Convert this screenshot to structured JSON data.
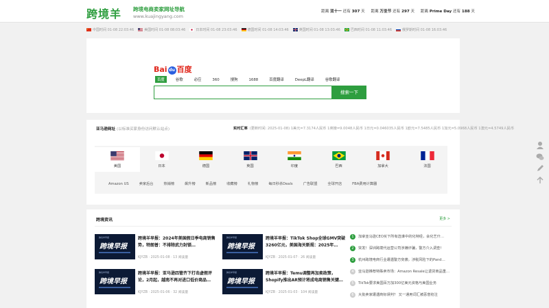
{
  "header": {
    "logo_mark": "跨境羊",
    "tagline": "跨境电商卖家网址导航",
    "domain": "www.kuajingyang.com",
    "countdowns": [
      {
        "pre": "距离",
        "name": "双十一",
        "mid": "还有",
        "days": "307",
        "unit": "天"
      },
      {
        "pre": "距离",
        "name": "万圣节",
        "mid": "还有",
        "days": "297",
        "unit": "天"
      },
      {
        "pre": "距离",
        "name": "Prime Day",
        "mid": "还有",
        "days": "188",
        "unit": "天"
      }
    ]
  },
  "timezones": [
    {
      "label": "中国时间 01-08 22:03:46",
      "flag": "cn"
    },
    {
      "label": "美国时间 01-08 08:03:46",
      "flag": "us"
    },
    {
      "label": "日本时间 01-08 23:03:46",
      "flag": "jp"
    },
    {
      "label": "德国时间 01-08 14:03:46",
      "flag": "de"
    },
    {
      "label": "英国时间 01-08 13:03:46",
      "flag": "gb"
    },
    {
      "label": "巴西时间 01-08 11:03:46",
      "flag": "br"
    },
    {
      "label": "俄罗斯时间 01-08 16:03:46",
      "flag": "ru"
    }
  ],
  "search": {
    "logo_left": "Bai",
    "logo_paw": "du",
    "logo_right": "百度",
    "tabs": [
      "百度",
      "谷歌",
      "必应",
      "360",
      "搜狗",
      "1688",
      "百度翻译",
      "DeepL翻译",
      "谷歌翻译"
    ],
    "active_tab": 0,
    "button": "搜索一下",
    "query": ""
  },
  "amazon": {
    "title": "亚马逊网址",
    "subtitle": "(以标准买家身份访问默认站点)",
    "rate_label": "实时汇率",
    "rate_text": "(更新时间: 2025-01-08) 1美元=7.3174人民币 1英镑=9.0048人民币 1日元=0.046035人民币 1欧元=7.5485人民币 1加元=5.0968人民币 1澳元=4.5749人民币",
    "sites": [
      "美国",
      "日本",
      "德国",
      "英国",
      "印度",
      "巴西",
      "加拿大",
      "法国"
    ],
    "active_site": 0,
    "links": [
      "Amazon US",
      "卖家后台",
      "热销榜",
      "飙升榜",
      "新品榜",
      "收藏榜",
      "礼物榜",
      "每日秒杀Deals",
      "广告联盟",
      "全球开店",
      "FBA费用计算器"
    ]
  },
  "news": {
    "title": "跨境资讯",
    "more": "更多 >",
    "thumb_title": "跨境早报",
    "thumb_brand": "跨境羊早报",
    "cards": [
      {
        "title": "跨境羊早报：2024年美国假日季电商销售势，特朗普：不排除武力封锁…",
        "date": "KJYZB · 2025-01-08 · 13 阅读量"
      },
      {
        "title": "跨境羊早报：TikTok Shop全球GMV突破3260亿元，美国海关新规：2025年…",
        "date": "KJYZB · 2025-01-07 · 26 阅读量"
      },
      {
        "title": "跨境羊早报：亚马逊四管齐下打击虚假评论，2月起，越南不再对进口低价商品…",
        "date": "KJYZB · 2025-01-06 · 32 阅读量"
      },
      {
        "title": "跨境羊早报：Temu调整再加卖政策，Shopify推出AR预计将成电商销售关键…",
        "date": "KJYZB · 2025-01-03 · 104 阅读量"
      }
    ],
    "list": [
      "加拿亚马逊CEO买下所有选谁中的化特经，会化艺什…",
      "突发！深圳跨境代运营公司涉嫌诈骗，警方介入调查!",
      "杭州跨境电商行业遭遇警方突袭，涉税风险下的Pand…",
      "亚马逊推荐特殊卖市场：Amazon Resale让退货商品重…",
      "TikTok要求美国百万加300亿美元资格与美国业务",
      "大批卖家遭遇商标误判？ 又一通用词汇被恶意抢注"
    ],
    "list_hot_count": 3
  }
}
